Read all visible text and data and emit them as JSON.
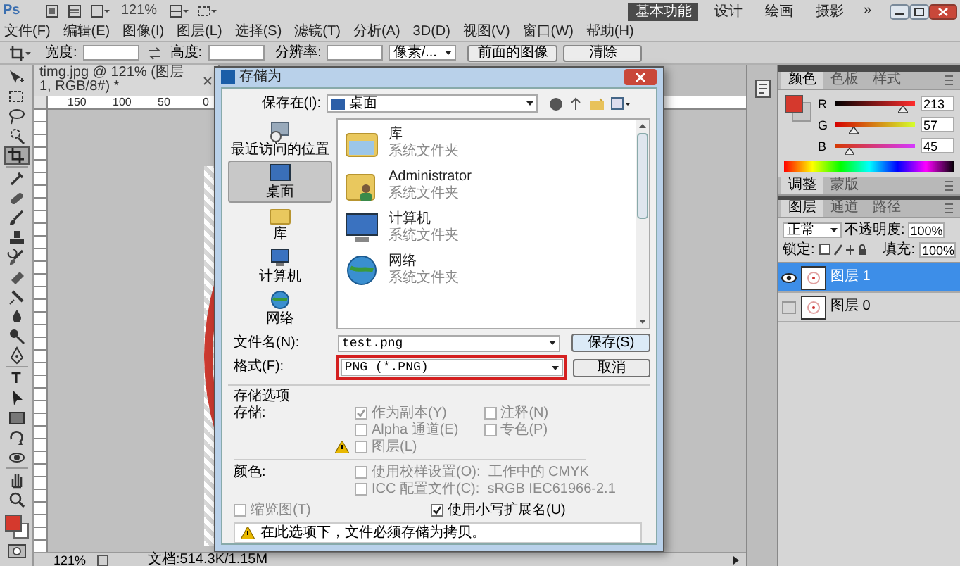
{
  "app_bar": {
    "logo": "Ps",
    "zoom": "121%",
    "workspaces": [
      {
        "label": "基本功能",
        "selected": true
      },
      {
        "label": "设计",
        "selected": false
      },
      {
        "label": "绘画",
        "selected": false
      },
      {
        "label": "摄影",
        "selected": false
      }
    ],
    "more": "»"
  },
  "menu": [
    "文件(F)",
    "编辑(E)",
    "图像(I)",
    "图层(L)",
    "选择(S)",
    "滤镜(T)",
    "分析(A)",
    "3D(D)",
    "视图(V)",
    "窗口(W)",
    "帮助(H)"
  ],
  "options_bar": {
    "width_label": "宽度:",
    "height_label": "高度:",
    "resolution_label": "分辨率:",
    "unit": "像素/...",
    "buttons": [
      "前面的图像",
      "清除"
    ]
  },
  "tools": [
    {
      "selected": false
    },
    {
      "selected": false
    },
    {
      "selected": false
    },
    {
      "selected": false
    },
    {
      "selected": true
    },
    {
      "selected": false
    },
    {
      "selected": false
    },
    {
      "selected": false
    },
    {
      "selected": false
    },
    {
      "selected": false
    },
    {
      "selected": false
    },
    {
      "selected": false
    },
    {
      "selected": false
    },
    {
      "selected": false
    },
    {
      "selected": false
    },
    {
      "selected": false,
      "glyph": "T"
    },
    {
      "selected": false
    },
    {
      "selected": false
    },
    {
      "selected": false
    },
    {
      "selected": false
    },
    {
      "selected": false
    },
    {
      "selected": false
    }
  ],
  "document": {
    "tab": "timg.jpg @ 121% (图层 1, RGB/8#) *",
    "ruler_marks": [
      "150",
      "100",
      "50",
      "0"
    ]
  },
  "status_bar": {
    "zoom": "121%",
    "doc_info": "文档:514.3K/1.15M"
  },
  "dialog": {
    "title": "存储为",
    "save_in_label": "保存在(I):",
    "save_in_value": "桌面",
    "places": [
      {
        "label": "最近访问的位置",
        "selected": false
      },
      {
        "label": "桌面",
        "selected": true
      },
      {
        "label": "库",
        "selected": false
      },
      {
        "label": "计算机",
        "selected": false
      },
      {
        "label": "网络",
        "selected": false
      }
    ],
    "files": [
      {
        "name": "库",
        "type": "系统文件夹"
      },
      {
        "name": "Administrator",
        "type": "系统文件夹"
      },
      {
        "name": "计算机",
        "type": "系统文件夹"
      },
      {
        "name": "网络",
        "type": "系统文件夹"
      }
    ],
    "file_name_label": "文件名(N):",
    "file_name": "test.png",
    "format_label": "格式(F):",
    "format": "PNG (*.PNG)",
    "format_highlighted": true,
    "save_button": "保存(S)",
    "cancel_button": "取消",
    "save_options_title": "存储选项",
    "save_label": "存储:",
    "save_checkboxes": [
      {
        "label": "作为副本(Y)",
        "checked": true,
        "disabled": true
      },
      {
        "label": "注释(N)",
        "checked": false,
        "disabled": true
      },
      {
        "label": "Alpha 通道(E)",
        "checked": false,
        "disabled": true
      },
      {
        "label": "专色(P)",
        "checked": false,
        "disabled": true
      },
      {
        "label": "图层(L)",
        "checked": false,
        "disabled": true,
        "warning": true
      }
    ],
    "color_label": "颜色:",
    "color_checkboxes": [
      {
        "label": "使用校样设置(O):  工作中的 CMYK",
        "checked": false,
        "disabled": true
      },
      {
        "label": "ICC 配置文件(C):  sRGB IEC61966-2.1",
        "checked": false,
        "disabled": true
      }
    ],
    "thumbnail": {
      "label": "缩览图(T)",
      "checked": false,
      "disabled": true
    },
    "lowercase": {
      "label": "使用小写扩展名(U)",
      "checked": true,
      "disabled": false
    },
    "warning": "在此选项下，文件必须存储为拷贝。"
  },
  "panels": {
    "color": {
      "tabs": [
        {
          "label": "颜色",
          "selected": true
        },
        {
          "label": "色板",
          "selected": false
        },
        {
          "label": "样式",
          "selected": false
        }
      ],
      "channels": [
        {
          "name": "R",
          "value": "213",
          "level": 0.835
        },
        {
          "name": "G",
          "value": "57",
          "level": 0.224
        },
        {
          "name": "B",
          "value": "45",
          "level": 0.176
        }
      ]
    },
    "adjust_tabs": [
      {
        "label": "调整",
        "selected": true
      },
      {
        "label": "蒙版",
        "selected": false
      }
    ],
    "layers": {
      "tabs": [
        {
          "label": "图层",
          "selected": true
        },
        {
          "label": "通道",
          "selected": false
        },
        {
          "label": "路径",
          "selected": false
        }
      ],
      "blend_mode": "正常",
      "opacity_label": "不透明度:",
      "opacity": "100%",
      "lock_label": "锁定:",
      "fill_label": "填充:",
      "fill": "100%",
      "items": [
        {
          "name": "图层 1",
          "selected": true,
          "visible": true
        },
        {
          "name": "图层 0",
          "selected": false,
          "visible": false
        }
      ]
    }
  }
}
